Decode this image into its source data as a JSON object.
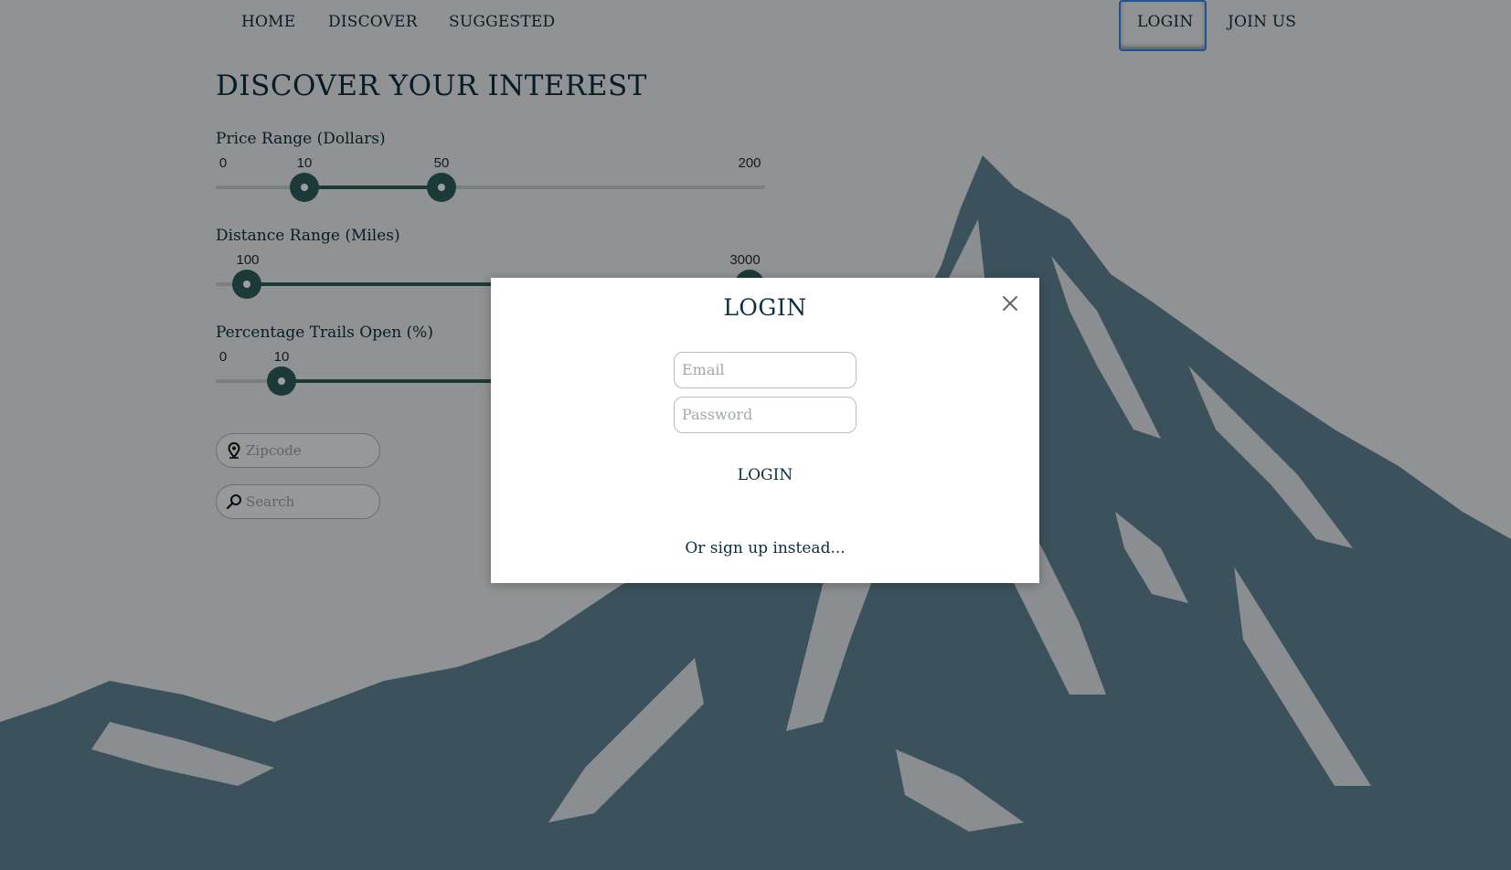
{
  "nav": {
    "home": "HOME",
    "discover": "DISCOVER",
    "suggested": "SUGGESTED",
    "login": "LOGIN",
    "join": "JOIN US"
  },
  "page": {
    "title": "DISCOVER YOUR INTEREST"
  },
  "filters": {
    "price": {
      "label": "Price Range (Dollars)",
      "min_label": "0",
      "low_label": "10",
      "high_label": "50",
      "max_label": "200",
      "min": 0,
      "max": 200,
      "low": 10,
      "high": 50
    },
    "distance": {
      "label": "Distance Range (Miles)",
      "low_label": "100",
      "high_label": "3000",
      "low": 100,
      "high": 3000
    },
    "trails": {
      "label": "Percentage Trails Open (%)",
      "min_label": "0",
      "low_label": "10",
      "low": 10
    }
  },
  "inputs": {
    "zipcode_placeholder": "Zipcode",
    "search_placeholder": "Search"
  },
  "modal": {
    "title": "LOGIN",
    "email_placeholder": "Email",
    "password_placeholder": "Password",
    "submit_label": "LOGIN",
    "signup_link": "Or sign up instead..."
  },
  "colors": {
    "accent": "#2d5e5b",
    "text": "#0d2e3d",
    "mountain": "#5f8494",
    "focus_ring": "#3b82f6"
  },
  "icons": {
    "zipcode": "map-pin-icon",
    "search": "search-icon",
    "close": "close-icon"
  }
}
